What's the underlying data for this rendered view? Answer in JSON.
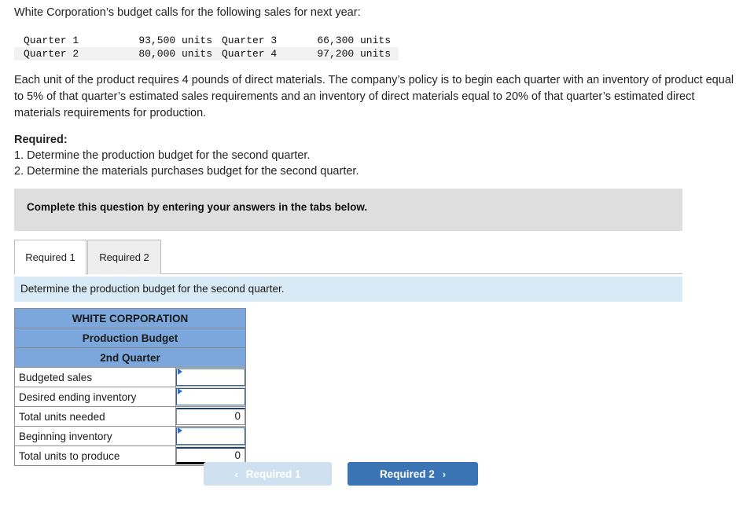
{
  "intro": "White Corporation’s budget calls for the following sales for next year:",
  "quarters": [
    {
      "label": "Quarter 1",
      "value": "93,500 units",
      "label2": "Quarter 3",
      "value2": "66,300 units"
    },
    {
      "label": "Quarter 2",
      "value": "80,000 units",
      "label2": "Quarter 4",
      "value2": "97,200 units"
    }
  ],
  "paragraph": "Each unit of the product requires 4 pounds of direct materials. The company’s policy is to begin each quarter with an inventory of product equal to 5% of that quarter’s estimated sales requirements and an inventory of direct materials equal to 20% of that quarter’s estimated direct materials requirements for production.",
  "required": {
    "heading": "Required:",
    "items": [
      "1. Determine the production budget for the second quarter.",
      "2. Determine the materials purchases budget for the second quarter."
    ]
  },
  "banner": "Complete this question by entering your answers in the tabs below.",
  "tabs": [
    {
      "label": "Required 1",
      "active": true
    },
    {
      "label": "Required 2",
      "active": false
    }
  ],
  "instruction": "Determine the production budget for the second quarter.",
  "budget_table": {
    "headers": [
      "WHITE CORPORATION",
      "Production Budget",
      "2nd Quarter"
    ],
    "rows": [
      {
        "label": "Budgeted sales",
        "value": "",
        "type": "input"
      },
      {
        "label": "Desired ending inventory",
        "value": "",
        "type": "input"
      },
      {
        "label": "Total units needed",
        "value": "0",
        "type": "calc"
      },
      {
        "label": "Beginning inventory",
        "value": "",
        "type": "input"
      },
      {
        "label": "Total units to produce",
        "value": "0",
        "type": "calc-total"
      }
    ]
  },
  "nav": {
    "prev_label": "Required 1",
    "prev_chevron": "‹",
    "next_label": "Required 2",
    "next_chevron": "›"
  },
  "colors": {
    "header_blue": "#7ba7dc",
    "instruction_blue": "#d9eaf7",
    "banner_gray": "#dedede",
    "button_blue": "#3b74b5",
    "button_disabled": "#cfe0f0",
    "input_border": "#2f5c9e"
  }
}
